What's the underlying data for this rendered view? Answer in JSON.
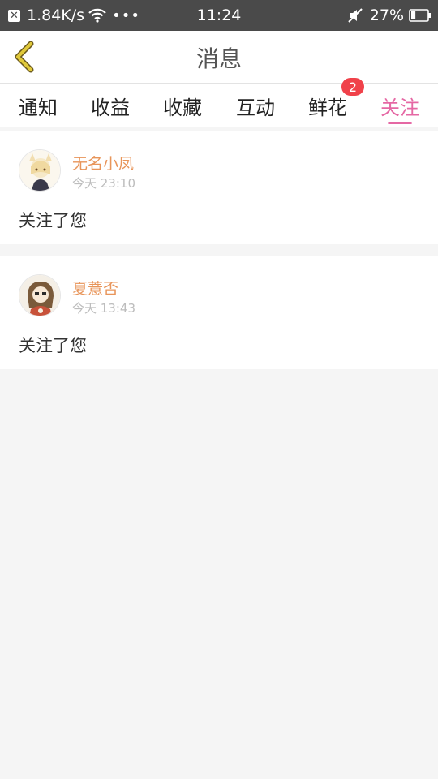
{
  "status_bar": {
    "speed": "1.84K/s",
    "time": "11:24",
    "battery": "27%",
    "battery_level": 0.27,
    "icons": [
      "close-box-icon",
      "wifi-icon",
      "more-dots-icon",
      "mute-icon",
      "battery-icon"
    ]
  },
  "header": {
    "title": "消息"
  },
  "tabs": [
    {
      "label": "通知",
      "active": false
    },
    {
      "label": "收益",
      "active": false
    },
    {
      "label": "收藏",
      "active": false
    },
    {
      "label": "互动",
      "active": false
    },
    {
      "label": "鲜花",
      "active": false,
      "badge": "2"
    },
    {
      "label": "关注",
      "active": true
    }
  ],
  "notifications": [
    {
      "username": "无名小凤",
      "time": "今天 23:10",
      "message": "关注了您"
    },
    {
      "username": "夏薏否",
      "time": "今天 13:43",
      "message": "关注了您"
    }
  ],
  "colors": {
    "accent": "#e568a4",
    "username": "#e8955a",
    "badge": "#f0414a",
    "status_bar": "#4a4a4a",
    "back_arrow": "#e0c93a"
  }
}
